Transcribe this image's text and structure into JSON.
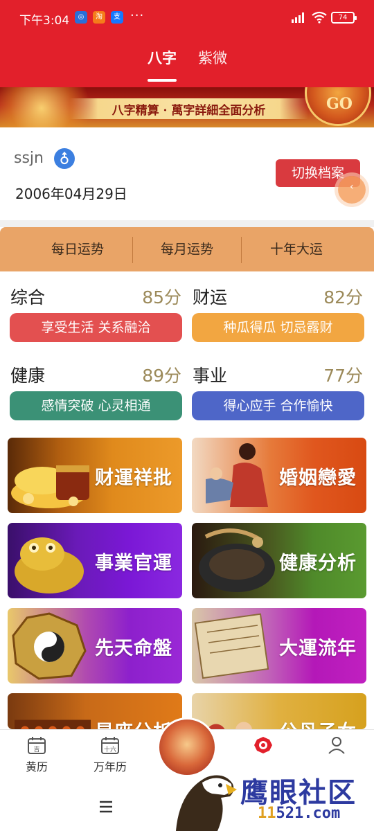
{
  "status_bar": {
    "time": "下午3:04",
    "app_icons": [
      "app-icon",
      "taobao-icon",
      "alipay-icon"
    ],
    "dots": "···",
    "battery": "74"
  },
  "tabs": [
    {
      "label": "八字",
      "active": true
    },
    {
      "label": "紫微",
      "active": false
    }
  ],
  "banner": {
    "text": "八字精算 · 萬字詳細全面分析",
    "go": "GO"
  },
  "profile": {
    "name": "ssjn",
    "gender_icon": "male-icon",
    "birth_date": "2006年04月29日",
    "switch_label": "切换档案"
  },
  "fortune_tabs": [
    {
      "label": "每日运势"
    },
    {
      "label": "每月运势"
    },
    {
      "label": "十年大运"
    }
  ],
  "scores": [
    {
      "label": "综合",
      "value": "85分",
      "tagline": "享受生活 关系融洽",
      "color": "#e35050"
    },
    {
      "label": "财运",
      "value": "82分",
      "tagline": "种瓜得瓜 切忌露财",
      "color": "#f2a641"
    },
    {
      "label": "健康",
      "value": "89分",
      "tagline": "感情突破 心灵相通",
      "color": "#3b9176"
    },
    {
      "label": "事业",
      "value": "77分",
      "tagline": "得心应手 合作愉快",
      "color": "#4e66c8"
    }
  ],
  "cards": [
    {
      "title": "财運祥批",
      "color": "#e08a1c"
    },
    {
      "title": "婚姻戀愛",
      "color": "#e0571e"
    },
    {
      "title": "事業官運",
      "color": "#7b18d6"
    },
    {
      "title": "健康分析",
      "color": "#4f8a2a"
    },
    {
      "title": "先天命盤",
      "color": "#8d20cc"
    },
    {
      "title": "大運流年",
      "color": "#b418b8"
    },
    {
      "title": "星座分析",
      "color": "#e07a18"
    },
    {
      "title": "公丹子女",
      "color": "#d6a11e"
    }
  ],
  "bottom_nav": [
    {
      "label": "黄历",
      "icon": "calendar-icon"
    },
    {
      "label": "万年历",
      "icon": "calendar-month-icon"
    },
    {
      "label": "",
      "icon": "center-feature-icon"
    },
    {
      "label": "",
      "icon": "bagua-icon"
    },
    {
      "label": "",
      "icon": "user-icon"
    }
  ],
  "watermark": {
    "text": "鹰眼社区",
    "url_part1": "11",
    "url_part2": "521.com"
  }
}
